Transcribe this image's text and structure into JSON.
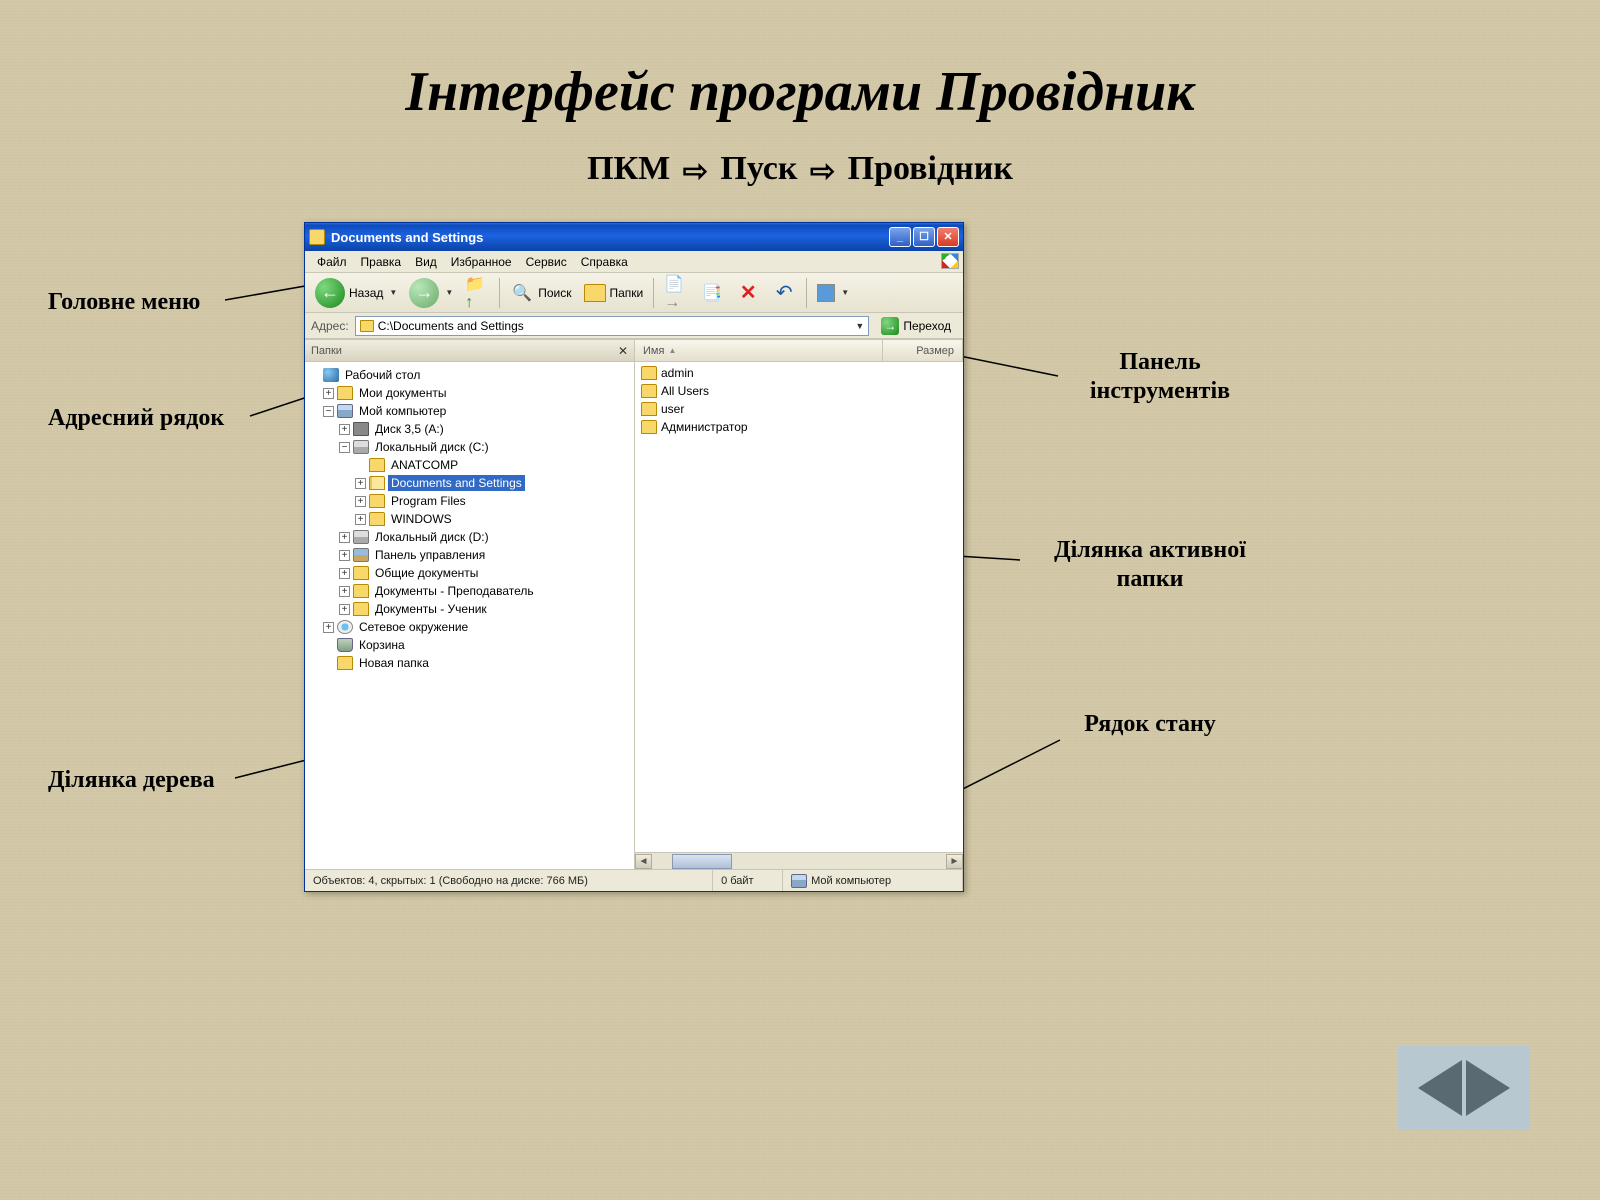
{
  "slide": {
    "title": "Інтерфейс програми Провідник",
    "sub_parts": [
      "ПКМ",
      "Пуск",
      "Провідник"
    ]
  },
  "labels": {
    "main_menu": "Головне меню",
    "address_bar": "Адресний рядок",
    "tree_area": "Ділянка дерева",
    "toolbar": "Панель інструментів",
    "active_folder": "Ділянка активної папки",
    "status_bar": "Рядок стану"
  },
  "window": {
    "title": "Documents and Settings",
    "menu": [
      "Файл",
      "Правка",
      "Вид",
      "Избранное",
      "Сервис",
      "Справка"
    ],
    "toolbar": {
      "back": "Назад",
      "search": "Поиск",
      "folders": "Папки"
    },
    "address": {
      "label": "Адрес:",
      "value": "C:\\Documents and Settings",
      "go": "Переход"
    },
    "tree_header": "Папки",
    "list_headers": {
      "name": "Имя",
      "size": "Размер"
    },
    "tree": {
      "desktop": "Рабочий стол",
      "mydocs": "Мои документы",
      "mycomp": "Мой компьютер",
      "floppy": "Диск 3,5 (A:)",
      "drive_c": "Локальный диск (C:)",
      "anatcomp": "ANATCOMP",
      "docset": "Documents and Settings",
      "progfiles": "Program Files",
      "windows": "WINDOWS",
      "drive_d": "Локальный диск (D:)",
      "cpanel": "Панель управления",
      "shared": "Общие документы",
      "docs_teacher": "Документы - Преподаватель",
      "docs_student": "Документы - Ученик",
      "network": "Сетевое окружение",
      "bin": "Корзина",
      "newfolder": "Новая папка"
    },
    "list": [
      "admin",
      "All Users",
      "user",
      "Администратор"
    ],
    "status": {
      "objects": "Объектов: 4, скрытых: 1 (Свободно на диске: 766 МБ)",
      "bytes": "0 байт",
      "location": "Мой компьютер"
    }
  }
}
